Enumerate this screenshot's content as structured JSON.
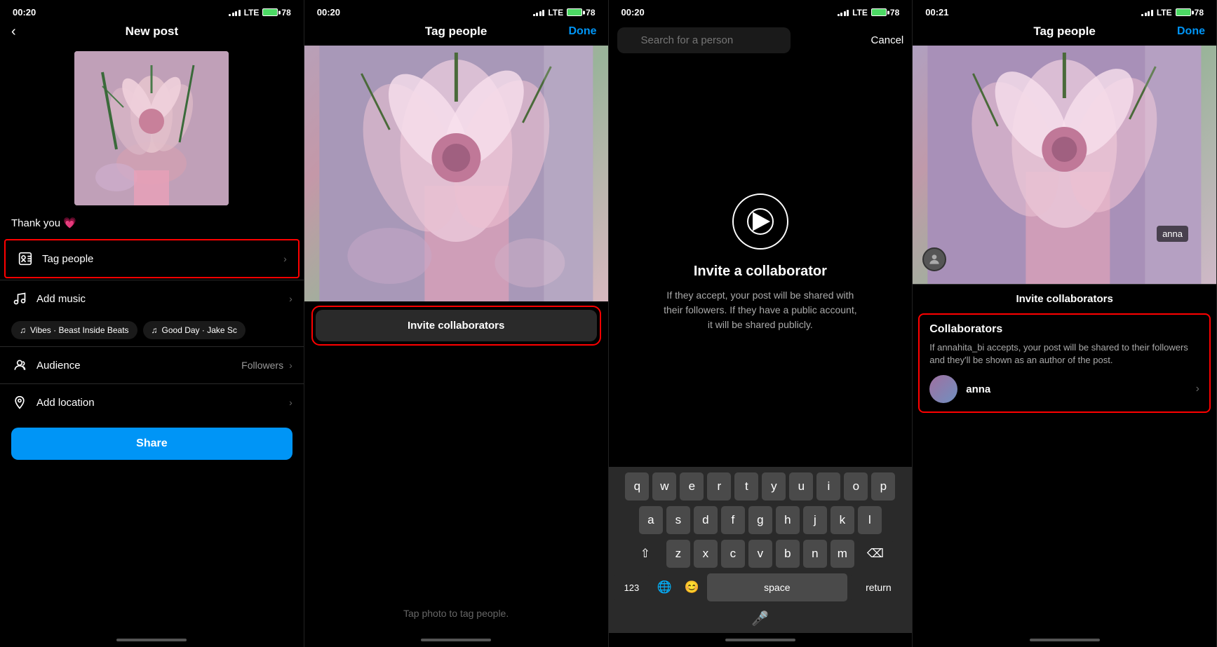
{
  "panel1": {
    "status_time": "00:20",
    "lte_label": "LTE",
    "battery_pct": "78",
    "title": "New post",
    "caption": "Thank you 💗",
    "menu": [
      {
        "id": "tag-people",
        "icon": "👤",
        "label": "Tag people",
        "value": "",
        "highlighted": true
      },
      {
        "id": "add-music",
        "icon": "♫",
        "label": "Add music",
        "value": ""
      },
      {
        "id": "audience",
        "icon": "👁",
        "label": "Audience",
        "value": "Followers"
      },
      {
        "id": "add-location",
        "icon": "📍",
        "label": "Add location",
        "value": ""
      }
    ],
    "music_chips": [
      {
        "label": "Vibes · Beast Inside Beats"
      },
      {
        "label": "Good Day · Jake Sc"
      }
    ],
    "share_label": "Share"
  },
  "panel2": {
    "status_time": "00:20",
    "lte_label": "LTE",
    "battery_pct": "78",
    "title": "Tag people",
    "done_label": "Done",
    "invite_btn_label": "Invite collaborators",
    "tap_hint": "Tap photo to tag people."
  },
  "panel3": {
    "status_time": "00:20",
    "lte_label": "LTE",
    "battery_pct": "78",
    "search_placeholder": "Search for a person",
    "cancel_label": "Cancel",
    "invite_icon": "▶",
    "invite_title": "Invite a collaborator",
    "invite_desc": "If they accept, your post will be shared with their followers. If they have a public account, it will be shared publicly.",
    "keyboard": {
      "row1": [
        "q",
        "w",
        "e",
        "r",
        "t",
        "y",
        "u",
        "i",
        "o",
        "p"
      ],
      "row2": [
        "a",
        "s",
        "d",
        "f",
        "g",
        "h",
        "j",
        "k",
        "l"
      ],
      "row3": [
        "z",
        "x",
        "c",
        "v",
        "b",
        "n",
        "m"
      ],
      "bottom": [
        "123",
        "😊",
        "space",
        "return"
      ]
    }
  },
  "panel4": {
    "status_time": "00:21",
    "lte_label": "LTE",
    "battery_pct": "78",
    "title": "Tag people",
    "done_label": "Done",
    "tag_name": "anna",
    "section_header": "Invite collaborators",
    "collab_title": "Collaborators",
    "collab_desc": "If annahita_bi accepts, your post will be shared to their followers and they'll be shown as an author of the post.",
    "collab_username": "anna"
  }
}
